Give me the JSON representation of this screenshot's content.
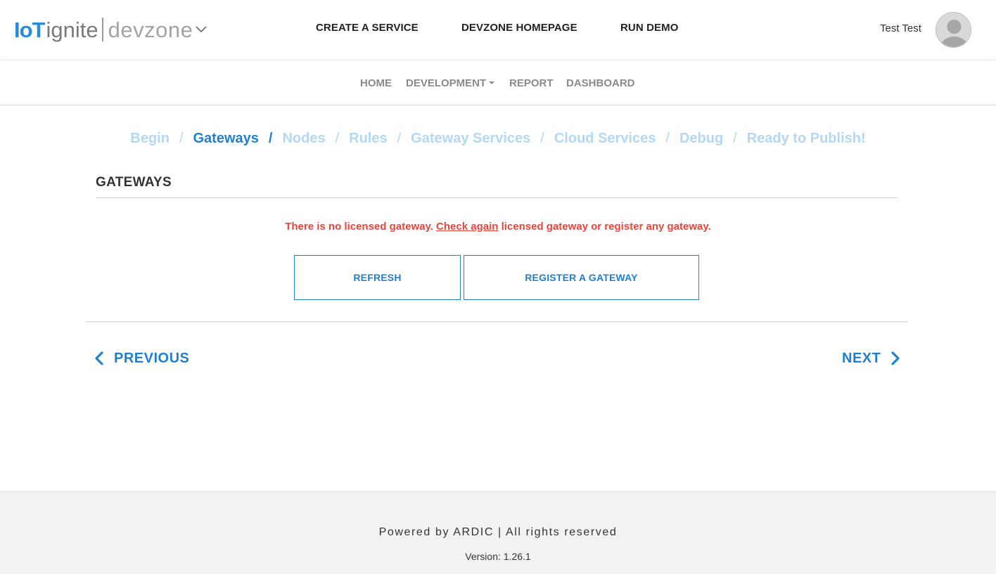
{
  "header": {
    "logo": {
      "iot": "IoT",
      "ignite": "ignite",
      "devzone": "devzone"
    },
    "nav": [
      {
        "label": "CREATE A SERVICE"
      },
      {
        "label": "DEVZONE HOMEPAGE"
      },
      {
        "label": "RUN DEMO"
      }
    ],
    "user": {
      "name": "Test Test"
    }
  },
  "subnav": {
    "items": [
      {
        "label": "HOME"
      },
      {
        "label": "DEVELOPMENT"
      },
      {
        "label": "REPORT"
      },
      {
        "label": "DASHBOARD"
      }
    ]
  },
  "steps": {
    "items": [
      {
        "label": "Begin",
        "active": false
      },
      {
        "label": "Gateways",
        "active": true
      },
      {
        "label": "Nodes",
        "active": false
      },
      {
        "label": "Rules",
        "active": false
      },
      {
        "label": "Gateway Services",
        "active": false
      },
      {
        "label": "Cloud Services",
        "active": false
      },
      {
        "label": "Debug",
        "active": false
      },
      {
        "label": "Ready to Publish!",
        "active": false
      }
    ],
    "separator": "/"
  },
  "section": {
    "title": "GATEWAYS",
    "warning_prefix": "There is no licensed gateway.",
    "warning_link": "Check again",
    "warning_suffix": "licensed gateway or register any gateway.",
    "refresh_label": "REFRESH",
    "register_label": "REGISTER A GATEWAY"
  },
  "pager": {
    "previous_label": "PREVIOUS",
    "next_label": "NEXT"
  },
  "footer": {
    "powered": "Powered by ARDIC | All rights reserved",
    "version": "Version: 1.26.1"
  },
  "colors": {
    "accent": "#1f7fd0",
    "accent_light": "#b3d8f5",
    "warning": "#e8453c",
    "logo_blue": "#2a8bd8"
  }
}
